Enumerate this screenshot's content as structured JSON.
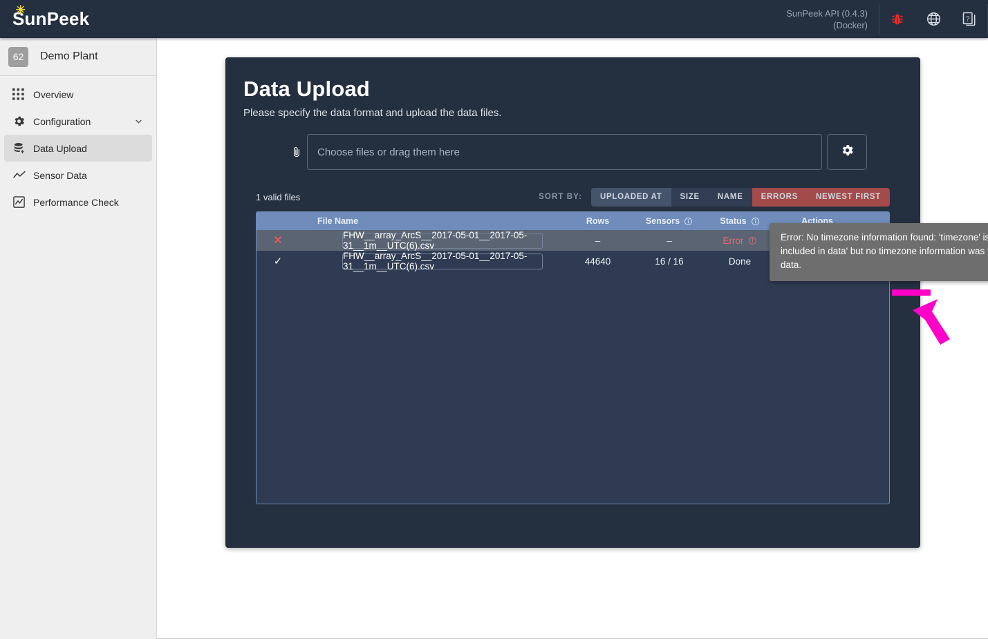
{
  "header": {
    "brand": "SunPeek",
    "api_line1": "SunPeek API (0.4.3)",
    "api_line2": "(Docker)",
    "icons": [
      "bug-icon",
      "globe-icon",
      "docs-icon"
    ],
    "bug_color": "#ef2d2d"
  },
  "sidebar": {
    "plant_badge": "62",
    "plant_name": "Demo Plant",
    "items": [
      {
        "label": "Overview",
        "icon": "grid-icon",
        "active": false
      },
      {
        "label": "Configuration",
        "icon": "gear-icon",
        "active": false,
        "chevron": "chevron-down-icon"
      },
      {
        "label": "Data Upload",
        "icon": "database-upload-icon",
        "active": true
      },
      {
        "label": "Sensor Data",
        "icon": "line-chart-icon",
        "active": false
      },
      {
        "label": "Performance Check",
        "icon": "chart-box-icon",
        "active": false
      }
    ]
  },
  "main": {
    "title": "Data Upload",
    "subtitle": "Please specify the data format and upload the data files.",
    "drop_placeholder": "Choose files or drag them here",
    "settings_icon": "gear-icon",
    "attach_icon": "paperclip-icon",
    "valid_files": "1 valid files",
    "sort_by_label": "SORT BY:",
    "sort_buttons": [
      "UPLOADED AT",
      "SIZE",
      "NAME",
      "ERRORS",
      "NEWEST FIRST"
    ],
    "table": {
      "headers": [
        "",
        "File Name",
        "Rows",
        "Sensors",
        "Status",
        "Actions"
      ],
      "header_info_icons": [
        "sensors-info-icon",
        "status-info-icon"
      ],
      "rows": [
        {
          "state_icon": "x-icon",
          "state": "error",
          "file_name": "FHW__array_ArcS__2017-05-01__2017-05-31__1m__UTC(6).csv",
          "rows": "–",
          "sensors": "–",
          "status": "Error",
          "status_info_icon": "error-info-icon",
          "actions": [
            "inspect-file-icon",
            "retry-icon",
            "delete-icon"
          ]
        },
        {
          "state_icon": "check-icon",
          "state": "done",
          "file_name": "FHW__array_ArcS__2017-05-01__2017-05-31__1m__UTC(6).csv",
          "rows": "44640",
          "sensors": "16 / 16",
          "status": "Done",
          "actions": [
            "delete-data-icon"
          ]
        }
      ]
    },
    "tooltip": "Error: No timezone information found: 'timezone' is set to 'UTC offset included in data' but no timezone information was found in the provided data."
  },
  "annotation": {
    "color": "#ff00c8",
    "marks": [
      "highlight-bar",
      "pointer-arrow"
    ],
    "points_at": "Done"
  },
  "colors": {
    "topbar": "#242f40",
    "panel": "#242f40",
    "sidebar": "#efefef",
    "table_header": "#6f8cba",
    "table_body": "#2e3b52",
    "error": "#ef6b6b",
    "accent": "#ff00c8"
  }
}
